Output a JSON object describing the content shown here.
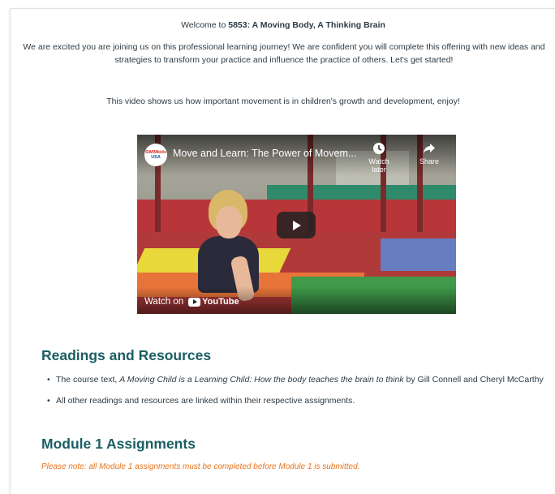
{
  "welcome": {
    "prefix": "Welcome to ",
    "course": "5853: A Moving Body, A Thinking Brain"
  },
  "intro": "We are excited you are joining us on this professional learning journey! We are confident you will complete this offering with new ideas and strategies to transform your practice and influence the practice of others. Let's get started!",
  "video_note": "This video shows us how important movement is in children's growth and development, enjoy!",
  "video": {
    "channel_logo_line1": "SWIMkids",
    "channel_logo_line2": "USA",
    "title": "Move and Learn: The Power of Movem...",
    "watch_later": "Watch later",
    "share": "Share",
    "watch_on": "Watch on",
    "youtube": "YouTube"
  },
  "readings": {
    "heading": "Readings and Resources",
    "item1_prefix": "The course text, ",
    "item1_title": "A Moving Child is a Learning Child: How the body teaches the brain to think",
    "item1_suffix": " by Gill Connell and Cheryl McCarthy",
    "item2": "All other readings and resources are linked within their respective assignments."
  },
  "module": {
    "heading": "Module 1 Assignments",
    "note": "Please note: all Module 1 assignments must be completed before Module 1 is submitted."
  },
  "colors": {
    "heading": "#1b5e64",
    "note": "#e8731c",
    "text": "#2d3b45"
  }
}
